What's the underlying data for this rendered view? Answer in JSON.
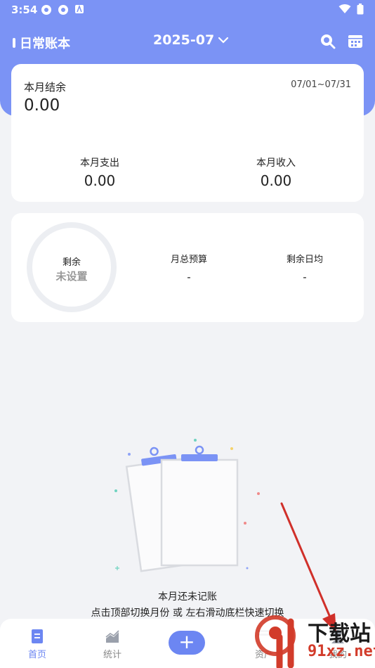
{
  "status_bar": {
    "time": "3:54"
  },
  "header": {
    "book_name": "日常账本",
    "month": "2025-07"
  },
  "summary": {
    "balance_label": "本月结余",
    "balance_value": "0.00",
    "date_range": "07/01~07/31",
    "expense_label": "本月支出",
    "expense_value": "0.00",
    "income_label": "本月收入",
    "income_value": "0.00"
  },
  "budget": {
    "ring_title": "剩余",
    "ring_status": "未设置",
    "monthly_budget_label": "月总预算",
    "monthly_budget_value": "-",
    "daily_avg_label": "剩余日均",
    "daily_avg_value": "-"
  },
  "empty_state": {
    "title": "本月还未记账",
    "hint": "点击顶部切换月份 或 左右滑动底栏快速切换"
  },
  "bottom_nav": {
    "items": [
      {
        "label": "首页",
        "icon": "document-icon",
        "active": true
      },
      {
        "label": "统计",
        "icon": "chart-icon"
      },
      {
        "label": "资产",
        "icon": "asset-icon"
      },
      {
        "label": "我的",
        "icon": "user-icon"
      }
    ],
    "add_label": "+"
  },
  "watermark": {
    "line1": "下载站",
    "line2": "91xz.net"
  },
  "colors": {
    "primary": "#7b93f5",
    "accent": "#6c86f2",
    "background": "#f2f3f6",
    "arrow": "#d0302a"
  }
}
